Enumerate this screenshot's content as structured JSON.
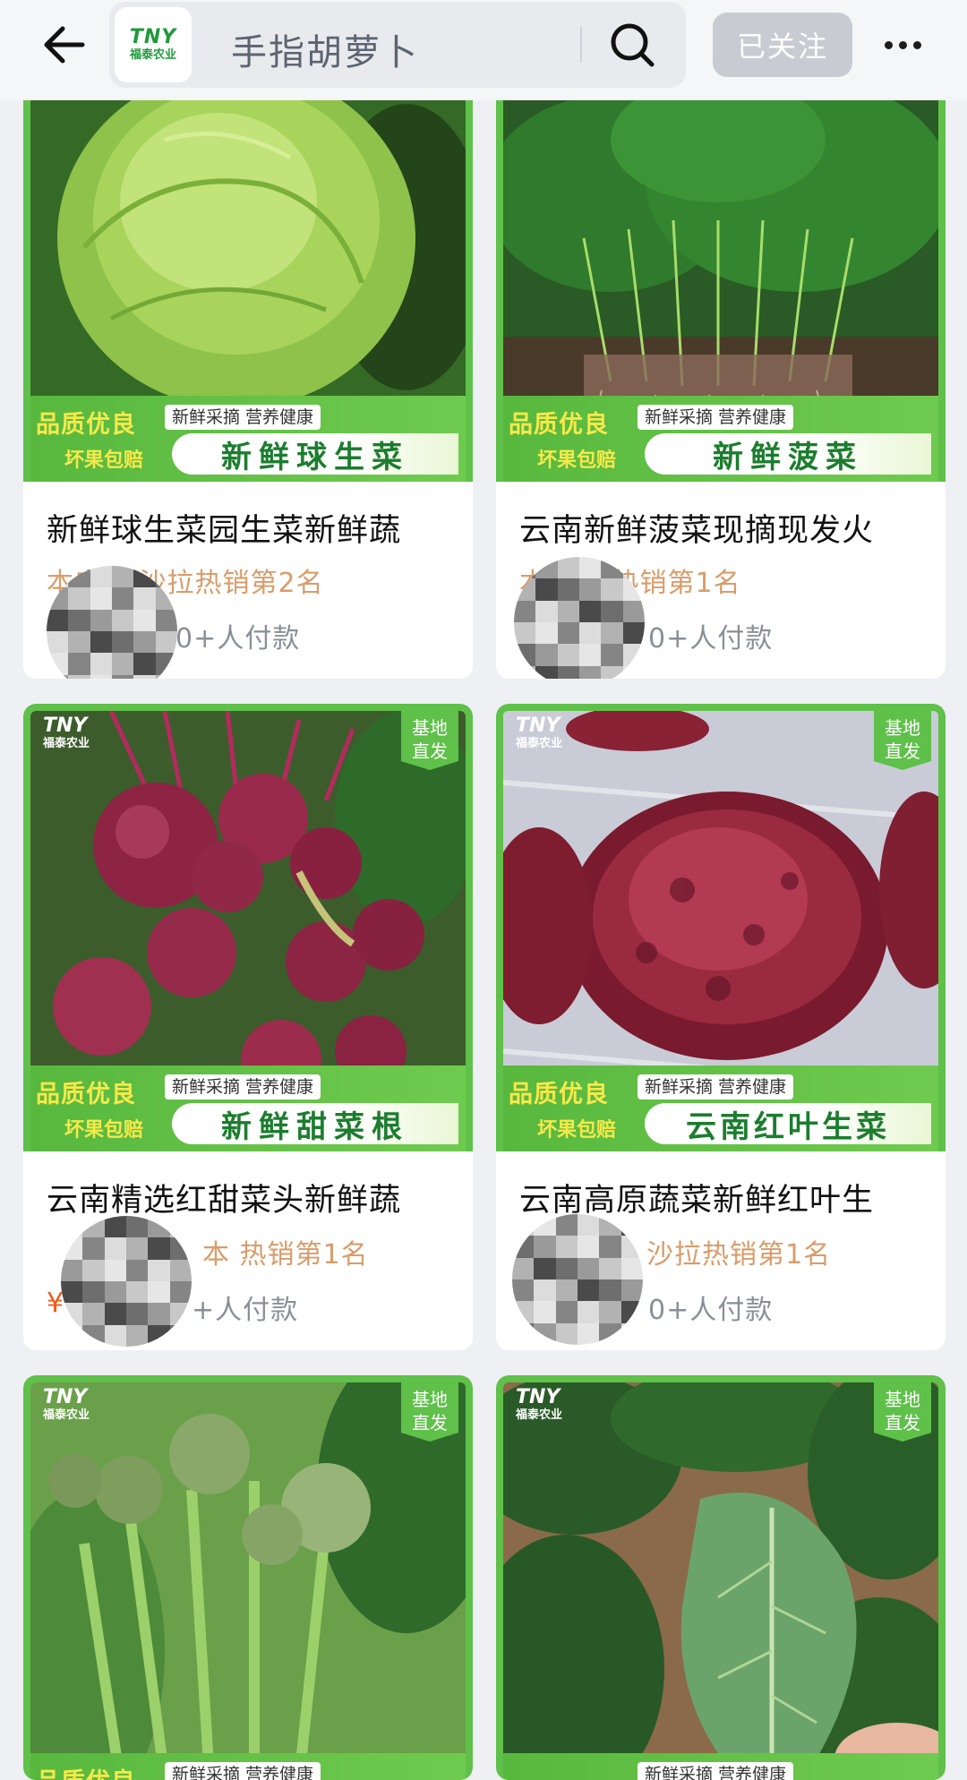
{
  "header": {
    "back_icon": "arrow-left-icon",
    "store_logo": {
      "mark": "TNY",
      "sub": "福泰农业"
    },
    "search_text": "手指胡萝卜",
    "search_icon": "search-icon",
    "follow_label": "已关注",
    "more_icon": "more-dots-icon"
  },
  "colors": {
    "banner_green": "#5fc04a",
    "promo_yellow": "#f6e94a",
    "rank_orange": "#d99c6a",
    "price_red": "#f05a1a",
    "follow_gray": "#c8ccd2"
  },
  "products": [
    {
      "title": "新鲜球生菜园生菜新鲜蔬",
      "rank_visible": "本店 菜沙拉热销第2名",
      "sales_visible": "0+人付款",
      "promo": {
        "line1": "品质优良",
        "line2": "坏果包赔",
        "tag": "新鲜采摘 营养健康",
        "name": "新鲜球生菜"
      },
      "has_direct_badge": false
    },
    {
      "title": "云南新鲜菠菜现摘现发火",
      "rank_visible": "本 菜类热销第1名",
      "sales_visible": "0+人付款",
      "promo": {
        "line1": "品质优良",
        "line2": "坏果包赔",
        "tag": "新鲜采摘 营养健康",
        "name": "新鲜菠菜"
      },
      "has_direct_badge": false
    },
    {
      "title": "云南精选红甜菜头新鲜蔬",
      "rank_visible": "本 热销第1名",
      "sales_visible": "+人付款",
      "price_symbol": "¥",
      "promo": {
        "line1": "品质优良",
        "line2": "坏果包赔",
        "tag": "新鲜采摘 营养健康",
        "name": "新鲜甜菜根"
      },
      "badge": {
        "mark": "TNY",
        "sub": "福泰农业",
        "direct_line1": "基地",
        "direct_line2": "直发"
      }
    },
    {
      "title": "云南高原蔬菜新鲜红叶生",
      "rank_visible": "沙拉热销第1名",
      "sales_visible": "0+人付款",
      "promo": {
        "line1": "品质优良",
        "line2": "坏果包赔",
        "tag": "新鲜采摘 营养健康",
        "name": "云南红叶生菜"
      },
      "badge": {
        "mark": "TNY",
        "sub": "福泰农业",
        "direct_line1": "基地",
        "direct_line2": "直发"
      }
    },
    {
      "promo": {
        "line1": "品质优良",
        "tag": "新鲜采摘 营养健康"
      },
      "badge": {
        "mark": "TNY",
        "sub": "福泰农业",
        "direct_line1": "基地",
        "direct_line2": "直发"
      }
    },
    {
      "promo": {
        "tag": "新鲜采摘 营养健康"
      },
      "badge": {
        "mark": "TNY",
        "sub": "福泰农业",
        "direct_line1": "基地",
        "direct_line2": "直发"
      }
    }
  ]
}
